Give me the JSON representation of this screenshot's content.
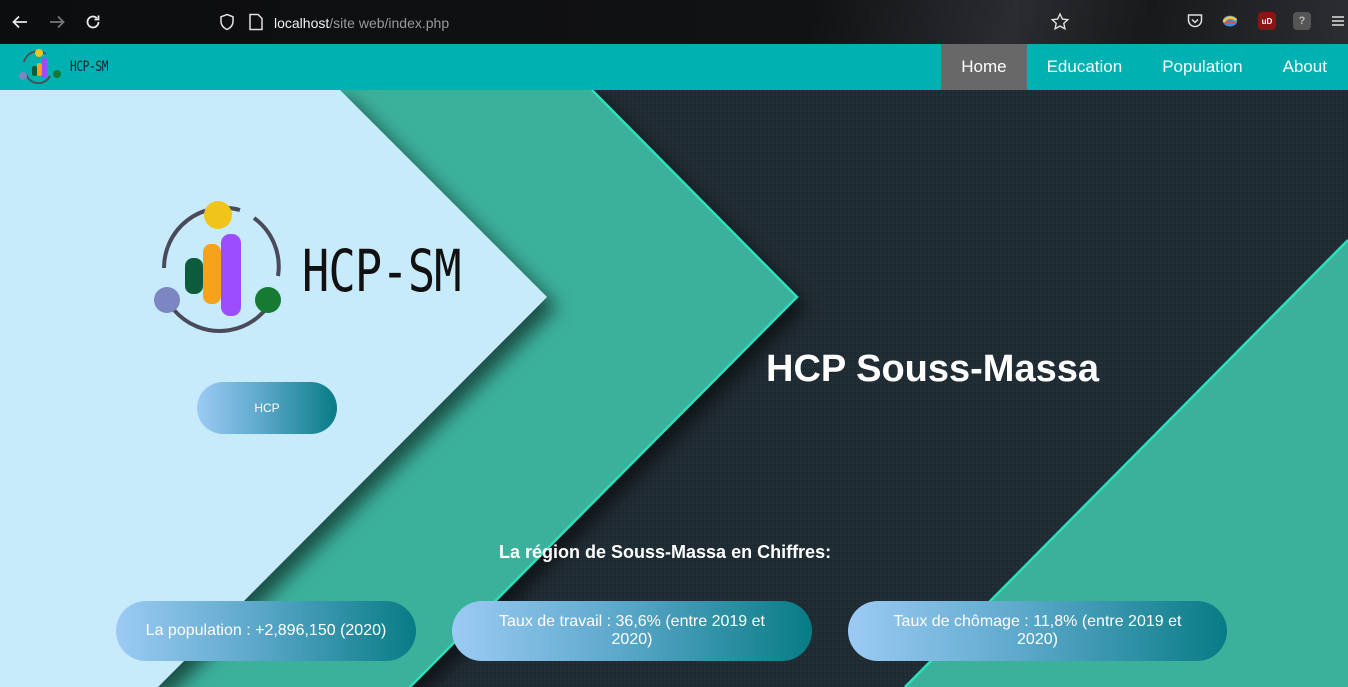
{
  "browser": {
    "url_host": "localhost",
    "url_path": "/site web/index.php",
    "icons": [
      "back-arrow-icon",
      "forward-arrow-icon",
      "reload-icon",
      "shield-icon",
      "page-icon",
      "bookmark-star-icon",
      "pocket-icon",
      "extension-icon",
      "ublock-icon",
      "privacy-icon",
      "hamburger-menu-icon"
    ],
    "ublock_label": "uD",
    "privacy_label": "?"
  },
  "header": {
    "logo_text": "HCP-SM",
    "menu": [
      {
        "label": "Home",
        "active": true
      },
      {
        "label": "Education",
        "active": false
      },
      {
        "label": "Population",
        "active": false
      },
      {
        "label": "About",
        "active": false
      }
    ],
    "bg_color": "#00b1b2",
    "active_color": "#686868"
  },
  "hero": {
    "logo_text": "HCP-SM",
    "button_label": "HCP",
    "title": "HCP Souss-Massa",
    "stats_heading": "La région de Souss-Massa en Chiffres:",
    "stats": [
      {
        "text": "La population : +2,896,150 (2020)"
      },
      {
        "text": "Taux de travail : 36,6% (entre 2019 et 2020)"
      },
      {
        "text": "Taux de chômage : 11,8% (entre 2019 et 2020)"
      }
    ],
    "colors": {
      "light_panel": "#c7ebfb",
      "teal_band": "#3bb09b",
      "dark_panel": "#1f2b33",
      "accent_line": "#2de0bd"
    }
  }
}
